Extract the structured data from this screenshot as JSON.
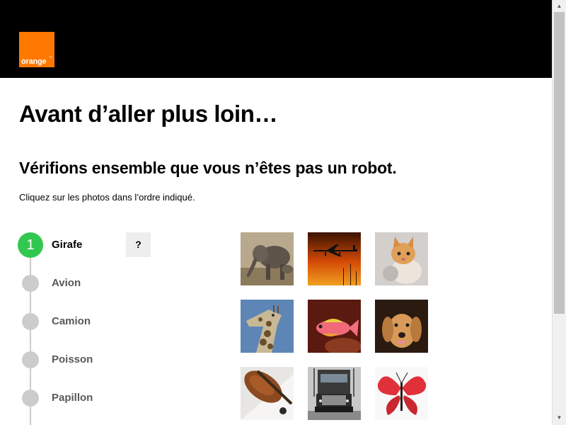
{
  "header": {
    "logo_text": "orange",
    "logo_tm": "™",
    "brand_color": "#ff7900"
  },
  "main": {
    "title": "Avant d’aller plus loin…",
    "subtitle": "Vérifions ensemble que vous n’êtes pas un robot.",
    "instruction": "Cliquez sur les photos dans l’ordre indiqué."
  },
  "steps": [
    {
      "number": "1",
      "label": "Girafe",
      "active": true
    },
    {
      "number": "",
      "label": "Avion",
      "active": false
    },
    {
      "number": "",
      "label": "Camion",
      "active": false
    },
    {
      "number": "",
      "label": "Poisson",
      "active": false
    },
    {
      "number": "",
      "label": "Papillon",
      "active": false
    }
  ],
  "help_button": {
    "label": "?"
  },
  "images": [
    {
      "subject": "elephant"
    },
    {
      "subject": "airplane"
    },
    {
      "subject": "kitten"
    },
    {
      "subject": "giraffe"
    },
    {
      "subject": "fish"
    },
    {
      "subject": "dog"
    },
    {
      "subject": "violin"
    },
    {
      "subject": "truck"
    },
    {
      "subject": "butterfly"
    }
  ],
  "colors": {
    "active_step": "#32c850",
    "inactive_step": "#cccccc",
    "header_bg": "#000000"
  },
  "scrollbar": {
    "up_arrow": "▲",
    "down_arrow": "▼"
  }
}
